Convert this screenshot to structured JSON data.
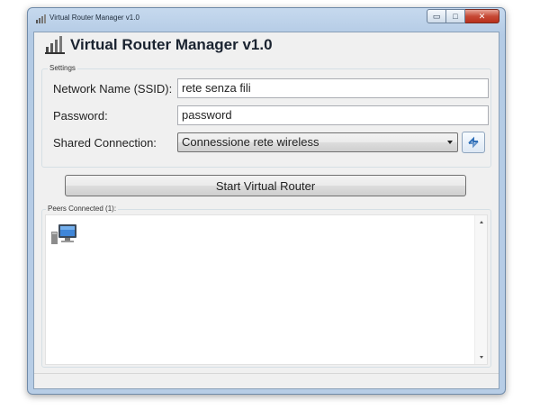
{
  "window": {
    "title": "Virtual Router Manager v1.0",
    "min_glyph": "▭",
    "max_glyph": "□",
    "close_glyph": "✕"
  },
  "header": {
    "title": "Virtual Router Manager v1.0",
    "icon": "router-signal-icon"
  },
  "settings": {
    "group_label": "Settings",
    "ssid_label": "Network Name (SSID):",
    "ssid_value": "rete senza fili",
    "password_label": "Password:",
    "password_value": "password",
    "shared_label": "Shared Connection:",
    "shared_value": "Connessione rete wireless",
    "refresh_icon": "refresh-icon"
  },
  "actions": {
    "start_label": "Start Virtual Router"
  },
  "peers": {
    "label": "Peers Connected (1):",
    "items": [
      {
        "icon": "computer-icon"
      }
    ]
  },
  "colors": {
    "accent": "#2f6fb8",
    "close_red": "#c74a36"
  }
}
